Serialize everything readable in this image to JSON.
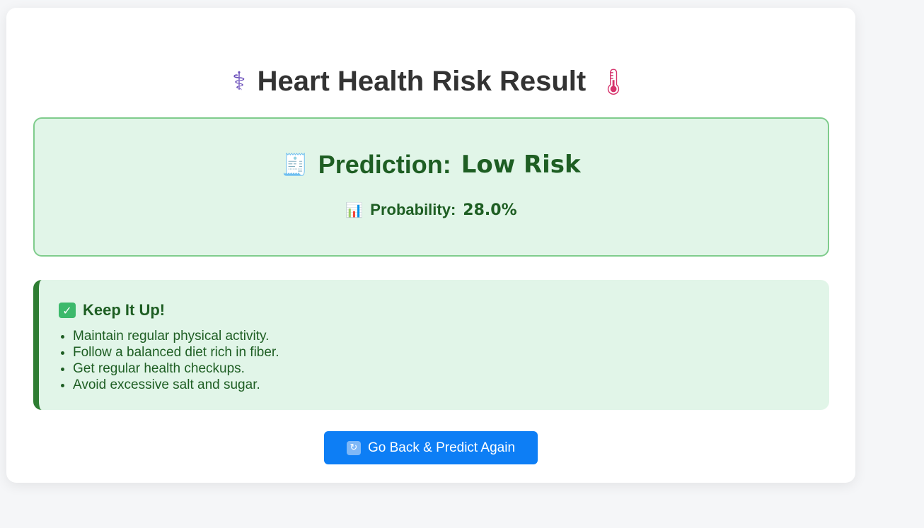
{
  "header": {
    "title": "Heart Health Risk Result",
    "left_icon": "stethoscope-icon",
    "left_glyph": "⚕",
    "right_icon": "thermometer-icon",
    "right_glyph": "🌡"
  },
  "prediction": {
    "label": "Prediction:",
    "value": "Low Risk",
    "icon": "receipt-icon",
    "icon_glyph": "🧾",
    "probability_label": "Probability:",
    "probability_value": "28.0%",
    "probability_icon": "bar-chart-icon",
    "probability_glyph": "📊"
  },
  "advice": {
    "heading": "Keep It Up!",
    "heading_icon": "check-mark-icon",
    "heading_glyph": "✓",
    "items": [
      "Maintain regular physical activity.",
      "Follow a balanced diet rich in fiber.",
      "Get regular health checkups.",
      "Avoid excessive salt and sugar."
    ]
  },
  "actions": {
    "back_label": "Go Back & Predict Again",
    "back_icon": "refresh-icon",
    "back_glyph": "↻"
  },
  "colors": {
    "success_bg": "#e1f5e8",
    "success_text": "#1e5e23",
    "success_border": "#7fcc8c",
    "accent_bar": "#2e7d32",
    "button": "#0d7ef5"
  }
}
